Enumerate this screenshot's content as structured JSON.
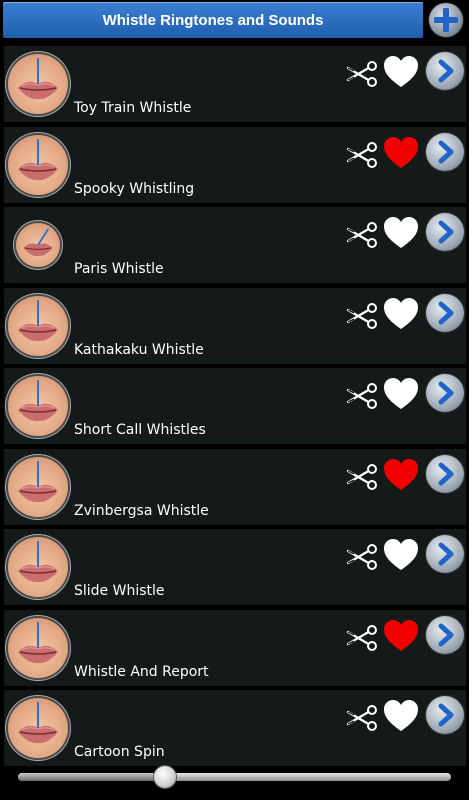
{
  "header": {
    "title": "Whistle Ringtones and Sounds",
    "add_icon": "plus-icon"
  },
  "rows": [
    {
      "label": "Toy Train Whistle",
      "favorite": false
    },
    {
      "label": "Spooky Whistling",
      "favorite": true
    },
    {
      "label": "Paris Whistle",
      "favorite": false
    },
    {
      "label": "Kathakaku Whistle",
      "favorite": false
    },
    {
      "label": "Short Call Whistles",
      "favorite": false
    },
    {
      "label": "Zvinbergsa Whistle",
      "favorite": true
    },
    {
      "label": "Slide Whistle",
      "favorite": false
    },
    {
      "label": "Whistle And Report",
      "favorite": true
    },
    {
      "label": "Cartoon Spin",
      "favorite": false
    }
  ],
  "icons": {
    "avatar": "lips-avatar-icon",
    "cut": "scissors-icon",
    "favorite": "heart-icon",
    "play": "chevron-right-icon"
  },
  "colors": {
    "header_blue": "#2b6fc2",
    "favorite_red": "#f20000",
    "favorite_white": "#ffffff",
    "row_bg": "#141a1a",
    "needle_blue": "#2f6fd8"
  },
  "playback": {
    "progress": 0.34
  }
}
